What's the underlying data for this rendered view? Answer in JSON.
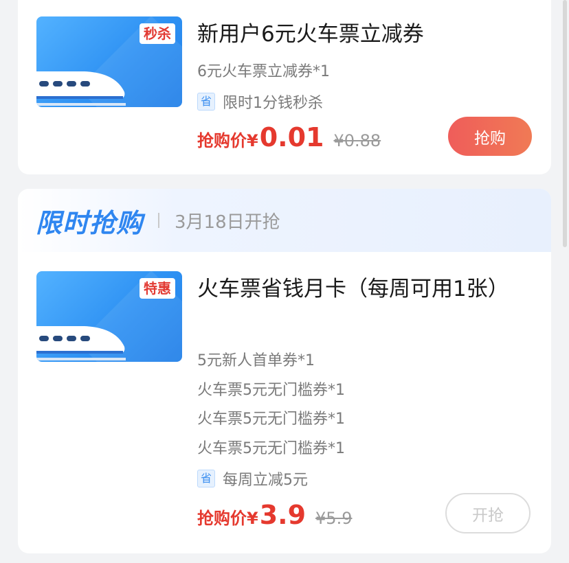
{
  "colors": {
    "accent_red": "#e5392e",
    "accent_blue": "#2f86f0",
    "bg": "#f2f3f5"
  },
  "card1": {
    "badge": "秒杀",
    "title": "新用户6元火车票立减券",
    "items": [
      "6元火车票立减券*1"
    ],
    "save_tag": "省",
    "save_text": "限时1分钱秒杀",
    "price_label": "抢购价¥",
    "price": "0.01",
    "old_price": "¥0.88",
    "button": "抢购"
  },
  "flash_sale": {
    "title": "限时抢购",
    "date": "3月18日开抢"
  },
  "card2": {
    "badge": "特惠",
    "title": "火车票省钱月卡（每周可用1张）",
    "items": [
      "5元新人首单券*1",
      "火车票5元无门槛券*1",
      "火车票5元无门槛券*1",
      "火车票5元无门槛券*1"
    ],
    "save_tag": "省",
    "save_text": "每周立减5元",
    "price_label": "抢购价¥",
    "price": "3.9",
    "old_price": "¥5.9",
    "button": "开抢"
  },
  "icons": {
    "train": "train-icon"
  }
}
